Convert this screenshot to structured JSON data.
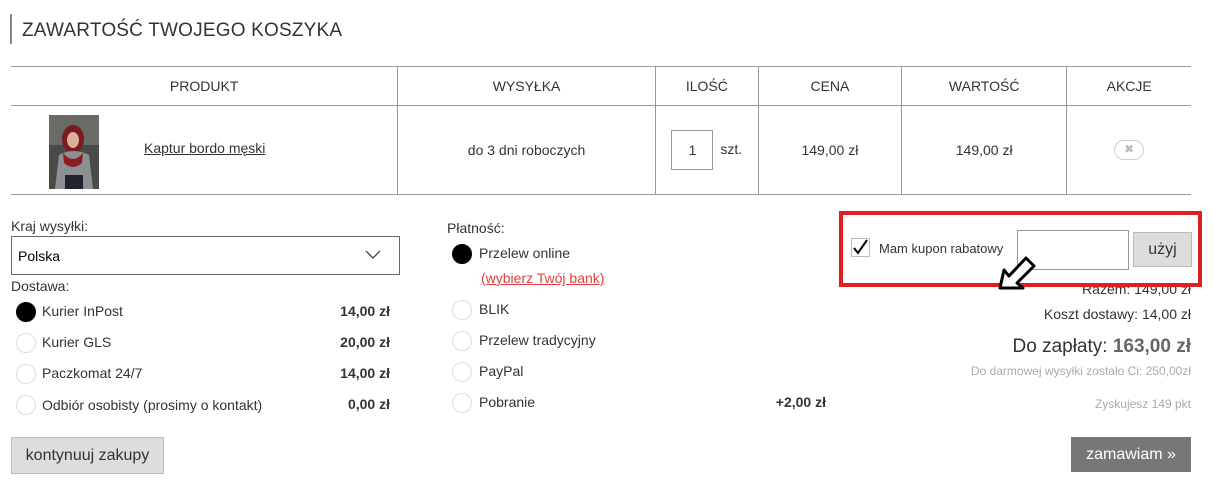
{
  "page_title": "ZAWARTOŚĆ TWOJEGO KOSZYKA",
  "table": {
    "headers": [
      "PRODUKT",
      "WYSYŁKA",
      "ILOŚĆ",
      "CENA",
      "WARTOŚĆ",
      "AKCJE"
    ],
    "rows": [
      {
        "product_name": "Kaptur bordo męski",
        "shipping": "do 3 dni roboczych",
        "quantity": "1",
        "unit": "szt.",
        "price": "149,00 zł",
        "value": "149,00 zł",
        "remove_glyph": "✖",
        "thumb_icon": "product-thumbnail"
      }
    ]
  },
  "country": {
    "label": "Kraj wysyłki:",
    "selected": "Polska"
  },
  "delivery": {
    "label": "Dostawa:",
    "options": [
      {
        "name": "Kurier InPost",
        "price": "14,00 zł",
        "checked": true
      },
      {
        "name": "Kurier GLS",
        "price": "20,00 zł",
        "checked": false
      },
      {
        "name": "Paczkomat 24/7",
        "price": "14,00 zł",
        "checked": false
      },
      {
        "name": "Odbiór osobisty (prosimy o kontakt)",
        "price": "0,00 zł",
        "checked": false
      }
    ]
  },
  "payment": {
    "label": "Płatność:",
    "bank_link": "(wybierz Twój bank)",
    "options": [
      {
        "name": "Przelew online",
        "checked": true,
        "extra": ""
      },
      {
        "name": "BLIK",
        "checked": false,
        "extra": ""
      },
      {
        "name": "Przelew tradycyjny",
        "checked": false,
        "extra": ""
      },
      {
        "name": "PayPal",
        "checked": false,
        "extra": ""
      },
      {
        "name": "Pobranie",
        "checked": false,
        "extra": "+2,00 zł"
      }
    ]
  },
  "coupon": {
    "checkbox_label": "Mam kupon rabatowy",
    "checked": true,
    "input_value": "",
    "button_label": "użyj",
    "highlight_color": "#e02020"
  },
  "summary": {
    "subtotal": "Razem: 149,00 zł",
    "shipping_cost": "Koszt dostawy: 14,00 zł",
    "to_pay_label": "Do zapłaty:",
    "to_pay_value": "163,00 zł",
    "free_shipping_note": "Do darmowej wysyłki zostało Ci: 250,00zł",
    "points": "Zyskujesz 149 pkt"
  },
  "buttons": {
    "continue": "kontynuuj zakupy",
    "order": "zamawiam »"
  }
}
